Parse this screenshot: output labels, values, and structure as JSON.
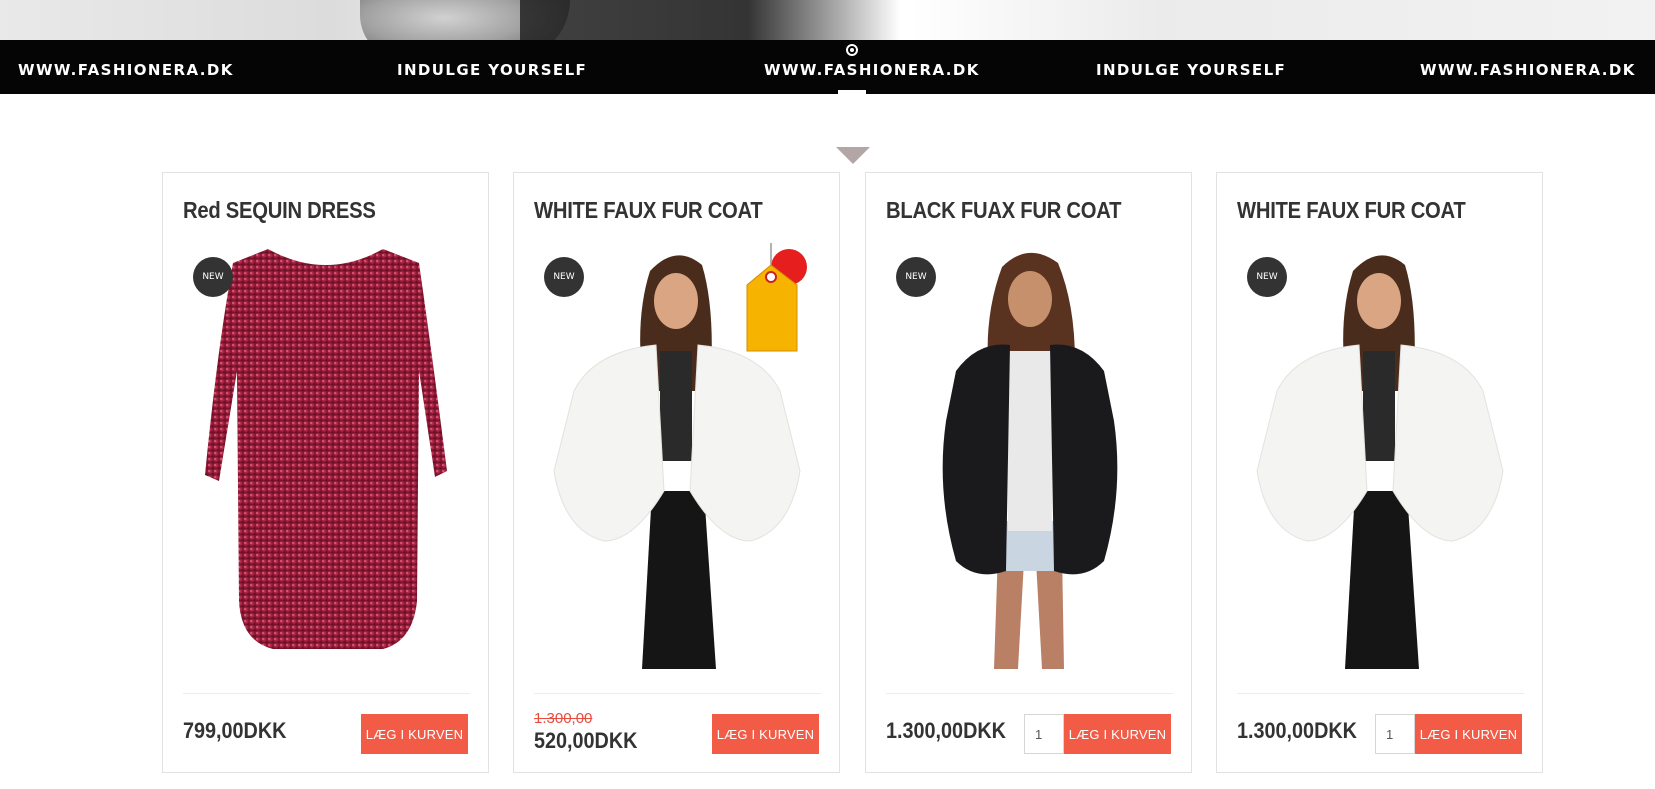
{
  "banner": {
    "items": [
      "WWW.FASHIONERA.DK",
      "INDULGE YOURSELF",
      "WWW.FASHIONERA.DK",
      "INDULGE YOURSELF",
      "WWW.FASHIONERA.DK"
    ]
  },
  "products": [
    {
      "title": "Red SEQUIN DRESS",
      "badge": "NEW",
      "price": "799,00DKK",
      "old_price": null,
      "button": "LÆG I KURVEN",
      "qty": null,
      "image": "red-sequin-dress"
    },
    {
      "title": "WHITE FAUX FUR COAT",
      "badge": "NEW",
      "price": "520,00DKK",
      "old_price": "1.300,00",
      "button": "LÆG I KURVEN",
      "qty": null,
      "image": "white-fur-coat",
      "sale_tag": "sale-tag-icon"
    },
    {
      "title": "BLACK FUAX FUR COAT",
      "badge": "NEW",
      "price": "1.300,00DKK",
      "old_price": null,
      "button": "LÆG I KURVEN",
      "qty": "1",
      "image": "black-fur-coat"
    },
    {
      "title": "WHITE FAUX FUR COAT",
      "badge": "NEW",
      "price": "1.300,00DKK",
      "old_price": null,
      "button": "LÆG I KURVEN",
      "qty": "1",
      "image": "white-fur-coat"
    }
  ],
  "colors": {
    "accent_button": "#f25b46",
    "badge": "#333333",
    "old_price": "#e84d3d",
    "banner": "#050505"
  }
}
